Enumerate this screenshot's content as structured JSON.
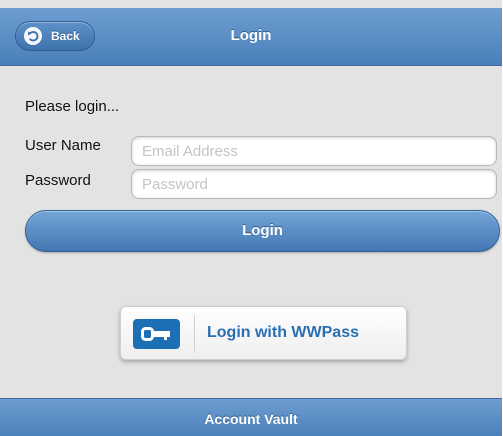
{
  "header": {
    "title": "Login",
    "back_label": "Back",
    "back_icon": "back-arrow-icon"
  },
  "form": {
    "intro": "Please login...",
    "username_label": "User Name",
    "username_placeholder": "Email Address",
    "username_value": "",
    "password_label": "Password",
    "password_placeholder": "Password",
    "password_value": "",
    "login_label": "Login"
  },
  "wwpass": {
    "label": "Login with WWPass",
    "icon": "key-icon"
  },
  "footer": {
    "title": "Account Vault"
  },
  "colors": {
    "accent": "#4a7fb9",
    "wwpass_text": "#2a6fb3",
    "wwpass_icon_bg": "#1d6fb5",
    "background": "#e3e3e3"
  }
}
